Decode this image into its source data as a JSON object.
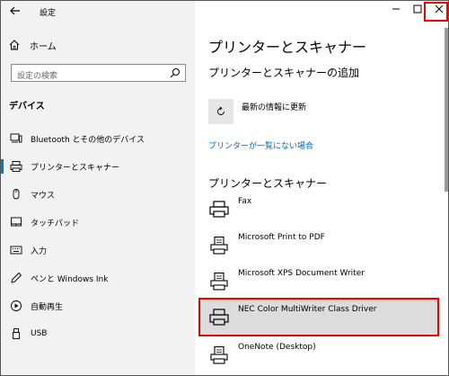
{
  "window": {
    "app_title": "設定",
    "controls": {
      "minimize": "—",
      "maximize": "☐",
      "close": "✕"
    }
  },
  "sidebar": {
    "home_label": "ホーム",
    "search_placeholder": "設定の検索",
    "section_title": "デバイス",
    "items": [
      {
        "label": "Bluetooth とその他のデバイス",
        "icon": "bluetooth-devices-icon"
      },
      {
        "label": "プリンターとスキャナー",
        "icon": "printer-icon",
        "active": true
      },
      {
        "label": "マウス",
        "icon": "mouse-icon"
      },
      {
        "label": "タッチパッド",
        "icon": "touchpad-icon"
      },
      {
        "label": "入力",
        "icon": "keyboard-icon"
      },
      {
        "label": "ペンと Windows Ink",
        "icon": "pen-icon"
      },
      {
        "label": "自動再生",
        "icon": "autoplay-icon"
      },
      {
        "label": "USB",
        "icon": "usb-icon"
      }
    ]
  },
  "main": {
    "page_title": "プリンターとスキャナー",
    "add_section_title": "プリンターとスキャナーの追加",
    "refresh_label": "最新の情報に更新",
    "not_listed_link": "プリンターが一覧にない場合",
    "list_section_title": "プリンターとスキャナー",
    "printers": [
      {
        "name": "Fax"
      },
      {
        "name": "Microsoft Print to PDF"
      },
      {
        "name": "Microsoft XPS Document Writer"
      },
      {
        "name": "NEC Color MultiWriter Class Driver",
        "selected": true
      },
      {
        "name": "OneNote (Desktop)"
      }
    ]
  },
  "colors": {
    "accent": "#0078d7",
    "link": "#0067c0",
    "highlight": "#e00000",
    "sidebar_bg": "#f2f2f2",
    "selected_bg": "#dcdcdc"
  }
}
